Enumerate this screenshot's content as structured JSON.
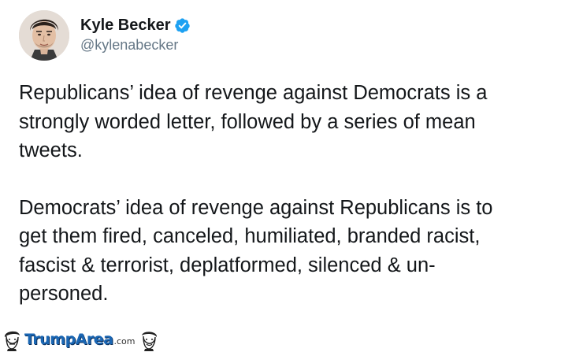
{
  "tweet": {
    "author": {
      "display_name": "Kyle Becker",
      "handle": "@kylenabecker",
      "verified": true
    },
    "paragraphs": [
      "Republicans’ idea of revenge against Democrats is a\nstrongly worded letter, followed by a series of mean\ntweets.",
      "Democrats’ idea of revenge against Republicans is to\nget them fired, canceled, humiliated, branded racist,\nfascist & terrorist, deplatformed, silenced & un-\npersoned."
    ]
  },
  "watermark": {
    "brand": "TrumpArea",
    "tld": ".com"
  },
  "colors": {
    "text": "#14171a",
    "secondary_text": "#657786",
    "verified_badge": "#1da1f2",
    "brand": "#1a66b3"
  }
}
